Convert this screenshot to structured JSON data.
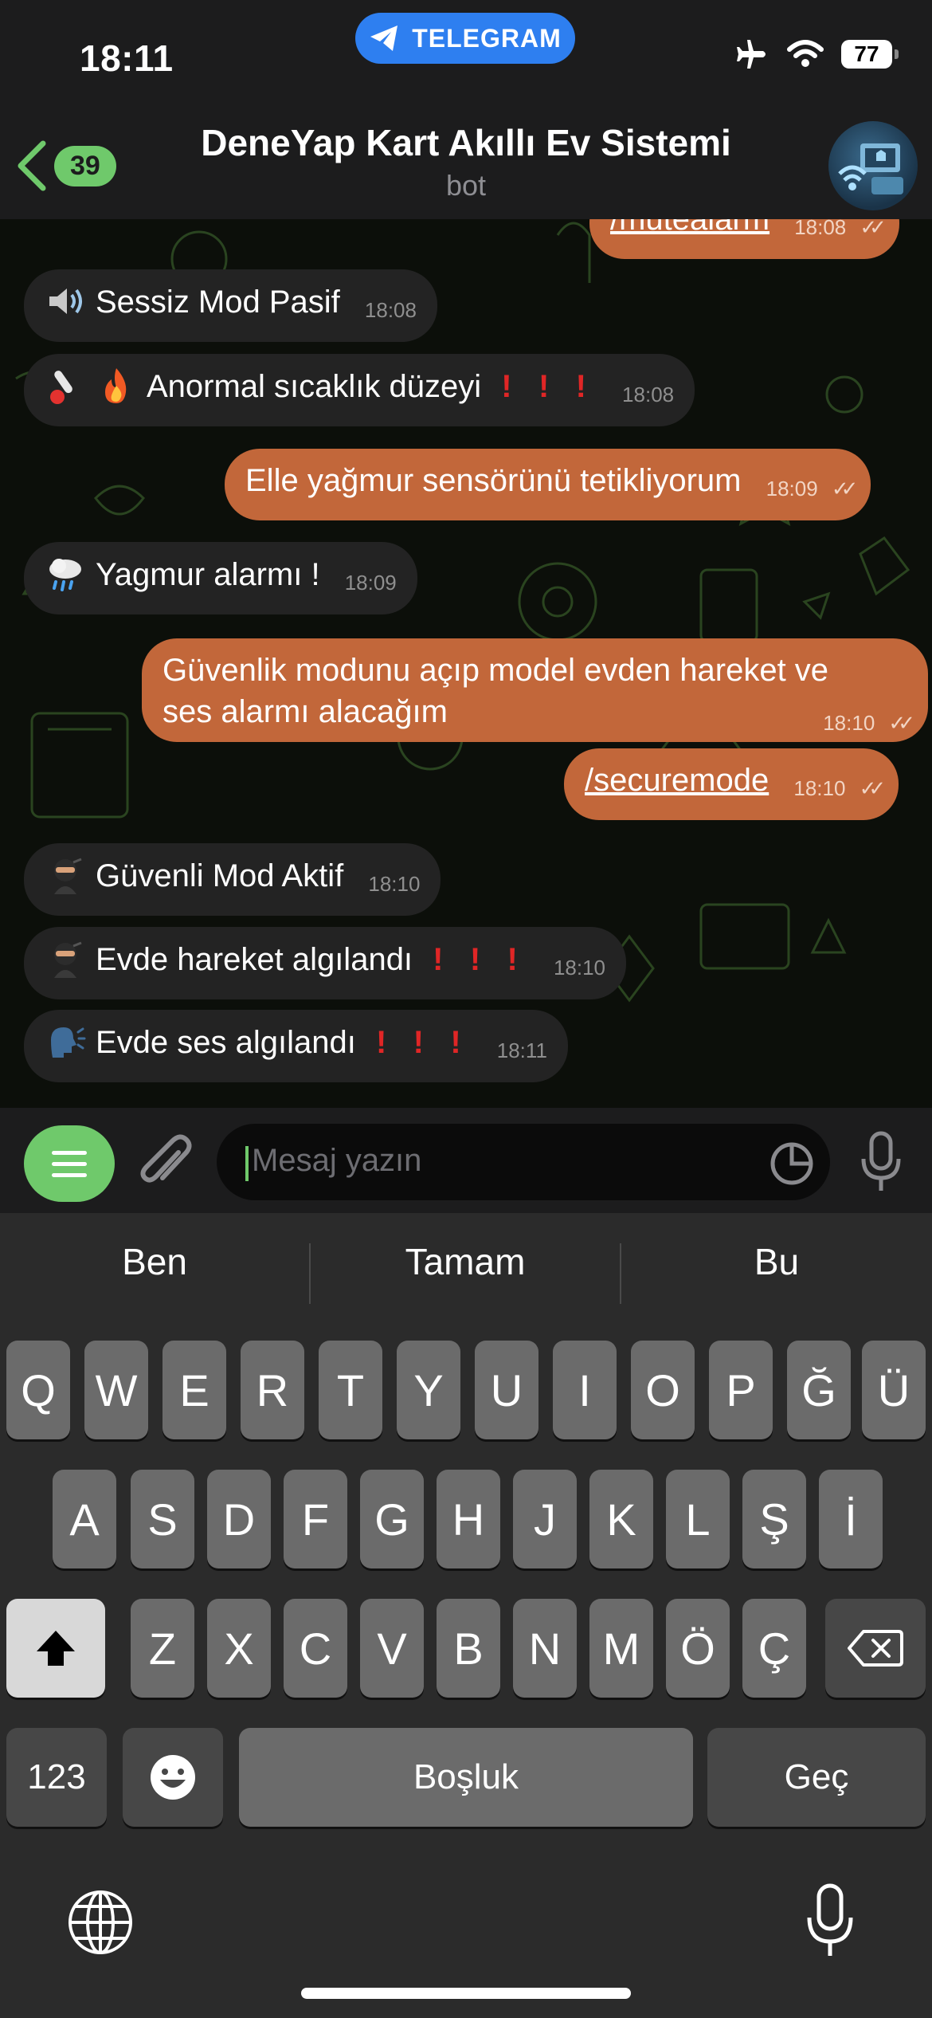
{
  "status_bar": {
    "time": "18:11",
    "app_pill": "TELEGRAM",
    "battery": "77"
  },
  "header": {
    "back_count": "39",
    "title": "DeneYap Kart Akıllı Ev Sistemi",
    "subtitle": "bot"
  },
  "messages": [
    {
      "dir": "out",
      "text": "/mutealarm",
      "time": "18:08"
    },
    {
      "dir": "in",
      "emoji": "speaker",
      "text": "Sessiz Mod Pasif",
      "time": "18:08"
    },
    {
      "dir": "in",
      "emoji": "thermometer+fire",
      "text": "Anormal sıcaklık düzeyi",
      "suffix": "❗️❗️❗️",
      "time": "18:08"
    },
    {
      "dir": "out",
      "text": "Elle yağmur sensörünü tetikliyorum",
      "time": "18:09"
    },
    {
      "dir": "in",
      "emoji": "rain-cloud",
      "text": "Yagmur alarmı !",
      "time": "18:09"
    },
    {
      "dir": "out",
      "text_line1": "Güvenlik modunu açıp model evden hareket ve",
      "text_line2": "ses alarmı alacağım",
      "time": "18:10"
    },
    {
      "dir": "out",
      "text": "/securemode",
      "time": "18:10"
    },
    {
      "dir": "in",
      "emoji": "ninja",
      "text": "Güvenli Mod Aktif",
      "time": "18:10"
    },
    {
      "dir": "in",
      "emoji": "ninja",
      "text": "Evde hareket algılandı",
      "suffix": "❗️❗️❗️",
      "time": "18:10"
    },
    {
      "dir": "in",
      "emoji": "speaking-head",
      "text": "Evde ses algılandı",
      "suffix": "❗️❗️❗️",
      "time": "18:11"
    }
  ],
  "input": {
    "placeholder": "Mesaj yazın"
  },
  "keyboard": {
    "suggestions": [
      "Ben",
      "Tamam",
      "Bu"
    ],
    "row1": [
      "Q",
      "W",
      "E",
      "R",
      "T",
      "Y",
      "U",
      "I",
      "O",
      "P",
      "Ğ",
      "Ü"
    ],
    "row2": [
      "A",
      "S",
      "D",
      "F",
      "G",
      "H",
      "J",
      "K",
      "L",
      "Ş",
      "İ"
    ],
    "row3": [
      "Z",
      "X",
      "C",
      "V",
      "B",
      "N",
      "M",
      "Ö",
      "Ç"
    ],
    "numbers": "123",
    "space": "Boşluk",
    "return": "Geç"
  },
  "colors": {
    "accent_green": "#6fc96b",
    "outgoing_bubble": "#c2673a",
    "incoming_bubble": "#232323",
    "pill_blue": "#2e7ff0"
  }
}
